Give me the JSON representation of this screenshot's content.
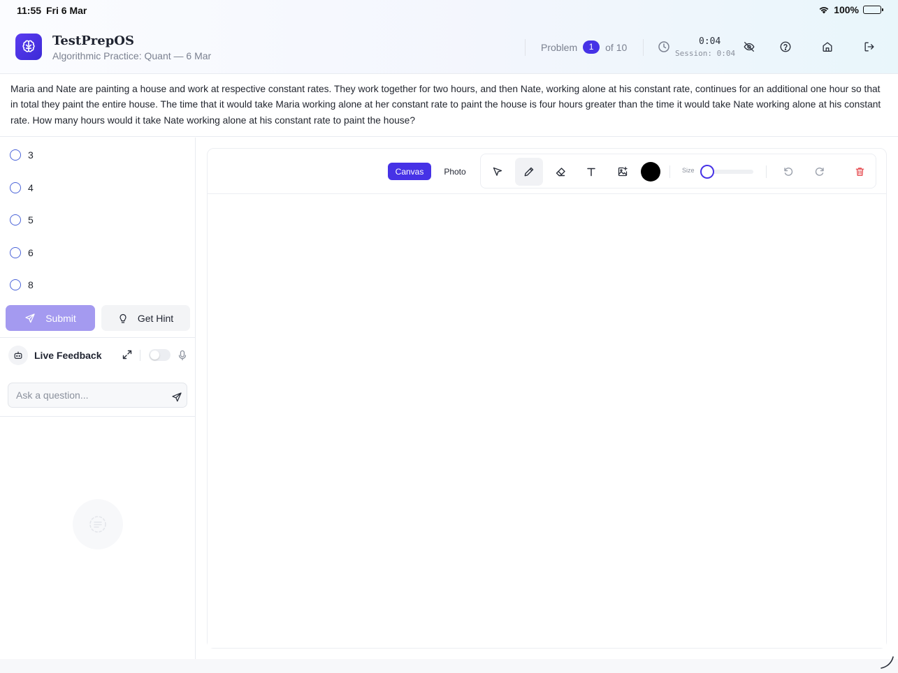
{
  "status": {
    "time": "11:55",
    "date": "Fri 6 Mar",
    "battery": "100%"
  },
  "header": {
    "title": "TestPrepOS",
    "subtitle": "Algorithmic Practice: Quant — 6 Mar",
    "problem_label": "Problem",
    "problem_current": "1",
    "problem_total": "of 10",
    "timer": "0:04",
    "session_timer": "Session: 0:04"
  },
  "question": {
    "text": "Maria and Nate are painting a house and work at respective constant rates. They work together for two hours, and then Nate, working alone at his constant rate, continues for an additional one hour so that in total they paint the entire house. The time that it would take Maria working alone at her constant rate to paint the house is four hours greater than the time it would take Nate working alone at his constant rate. How many hours would it take Nate working alone at his constant rate to paint the house?"
  },
  "options": [
    "3",
    "4",
    "5",
    "6",
    "8"
  ],
  "actions": {
    "submit": "Submit",
    "hint": "Get Hint"
  },
  "feedback": {
    "label": "Live Feedback",
    "enabled": false
  },
  "chat": {
    "placeholder": "Ask a question..."
  },
  "canvas": {
    "tab_canvas": "Canvas",
    "tab_photo": "Photo",
    "active_tab": "Canvas",
    "active_tool": "pen-icon",
    "size_label": "Size",
    "brush_size": 0,
    "color": "#000000",
    "accent": "#4632e6",
    "delete_color": "#e5484d"
  }
}
